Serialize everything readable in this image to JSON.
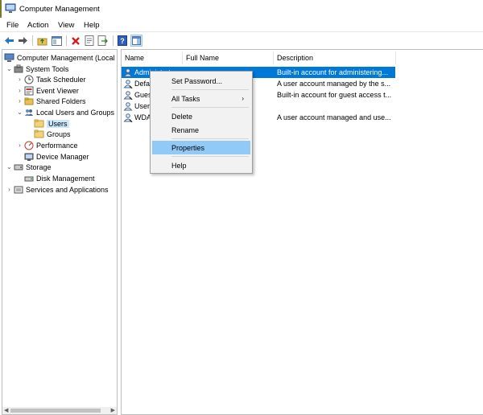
{
  "window": {
    "title": "Computer Management"
  },
  "menu": [
    "File",
    "Action",
    "View",
    "Help"
  ],
  "toolbar": {
    "icons": [
      "back-arrow-icon",
      "forward-arrow-icon",
      "up-folder-icon",
      "show-hide-tree-icon",
      "delete-icon",
      "properties-icon",
      "export-list-icon",
      "help-icon",
      "show-action-pane-icon"
    ]
  },
  "tree": {
    "items": [
      {
        "label": "Computer Management (Local"
      },
      {
        "label": "System Tools"
      },
      {
        "label": "Task Scheduler"
      },
      {
        "label": "Event Viewer"
      },
      {
        "label": "Shared Folders"
      },
      {
        "label": "Local Users and Groups"
      },
      {
        "label": "Users"
      },
      {
        "label": "Groups"
      },
      {
        "label": "Performance"
      },
      {
        "label": "Device Manager"
      },
      {
        "label": "Storage"
      },
      {
        "label": "Disk Management"
      },
      {
        "label": "Services and Applications"
      }
    ],
    "selected": "Users"
  },
  "list": {
    "columns": [
      "Name",
      "Full Name",
      "Description"
    ],
    "rows": [
      {
        "name": "Administrator",
        "full_name": "",
        "description": "Built-in account for administering..."
      },
      {
        "name": "Defau",
        "full_name": "",
        "description": "A user account managed by the s..."
      },
      {
        "name": "Gues",
        "full_name": "",
        "description": "Built-in account for guest access t..."
      },
      {
        "name": "User",
        "full_name": "",
        "description": ""
      },
      {
        "name": "WDA",
        "full_name": "",
        "description": "A user account managed and use..."
      }
    ],
    "selected_row": "Administrator"
  },
  "context_menu": {
    "items": [
      "Set Password...",
      "All Tasks",
      "Delete",
      "Rename",
      "Properties",
      "Help"
    ],
    "submenu_arrow": "›",
    "highlighted": "Properties"
  },
  "colors": {
    "selection": "#0078d7",
    "menu_highlight": "#91c9f7",
    "tree_selection": "#cce8ff"
  }
}
